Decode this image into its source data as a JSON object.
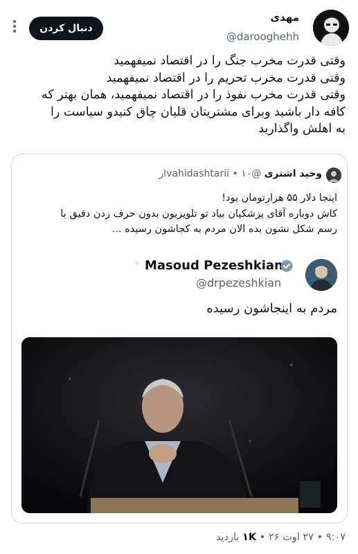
{
  "author": {
    "name": "مهدی",
    "handle": "@darooghehh"
  },
  "actions": {
    "follow_label": "دنبال کردن",
    "more_icon": "more-vertical-icon"
  },
  "tweet": {
    "lines": [
      "وقتی قدرت مخرب جنگ را در اقتصاد نمیفهمید",
      "وقتی قدرت مخرب تحریم را در اقتصاد نمیفهمید",
      "وقتی قدرت مخرب نفوذ را در اقتصاد نمیفهمید، همان بهتر که",
      "کافه دار باشید وبرای مشتریتان قلیان چاق کنیدو سیاست را",
      "به اهلش واگذارید"
    ]
  },
  "quote": {
    "author_name": "وحید اشتری",
    "author_handle": "@vahidashtarii",
    "age": "۱۰ار",
    "lines": [
      "اینجا دلار ۵۵ هزارتومان بود!",
      "کاش دوباره آقای پزشکیان بیاد تو تلویزیون بدون حرف زدن دقیق با",
      "رسم شکل نشون بده الان مردم به کجاشون رسیده ..."
    ],
    "embedded": {
      "name": "Masoud Pezeshkian",
      "handle": "@drpezeshkian",
      "text": "مردم به اینجاشون رسیده"
    }
  },
  "meta": {
    "time": "۹:۰۷",
    "date": "۲۷ اوت ۲۶",
    "views_count": "۱K",
    "views_label": "بازدید",
    "separator": "•"
  },
  "colors": {
    "text": "#0f1419",
    "secondary": "#536471",
    "border": "#cfd9de",
    "verified": "#1d9bf0"
  }
}
